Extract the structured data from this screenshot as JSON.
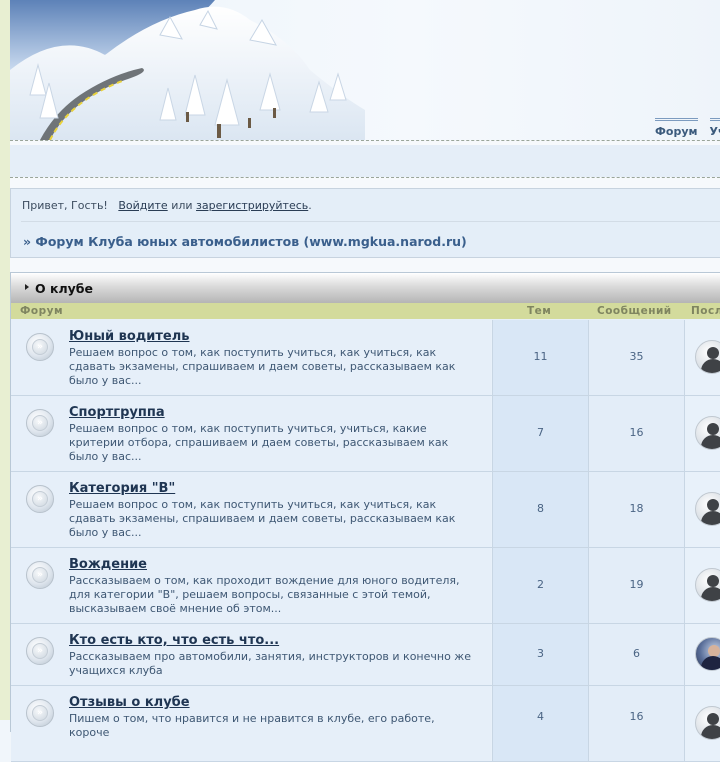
{
  "header": {
    "nav": [
      "Форум",
      "Уч"
    ]
  },
  "welcome": {
    "greeting": "Привет, Гость!",
    "login_link": "Войдите",
    "or_text": "или",
    "register_link": "зарегистрируйтесь",
    "breadcrumb": "» Форум Клуба юных автомобилистов (www.mgkua.narod.ru)"
  },
  "category": {
    "title": "О клубе",
    "columns": {
      "forum": "Форум",
      "topics": "Тем",
      "posts": "Сообщений",
      "last": "Посл"
    }
  },
  "forums": [
    {
      "title": "Юный водитель",
      "desc": "Решаем вопрос о том, как поступить учиться, как учиться, как сдавать экзамены, спрашиваем и даем советы, рассказываем как было у вас...",
      "topics": "11",
      "posts": "35",
      "avatar": "default"
    },
    {
      "title": "Спортгруппа",
      "desc": "Решаем вопрос о том, как поступить учиться, учиться, какие критерии отбора, спрашиваем и даем советы, рассказываем как было у вас...",
      "topics": "7",
      "posts": "16",
      "avatar": "default"
    },
    {
      "title": "Категория \"В\"",
      "desc": "Решаем вопрос о том, как поступить учиться, как учиться, как сдавать экзамены, спрашиваем и даем советы, рассказываем как было у вас...",
      "topics": "8",
      "posts": "18",
      "avatar": "default"
    },
    {
      "title": "Вождение",
      "desc": "Рассказываем о том, как проходит вождение для юного водителя, для категории \"В\", решаем вопросы, связанные с этой темой, высказываем своё мнение об этом...",
      "topics": "2",
      "posts": "19",
      "avatar": "default"
    },
    {
      "title": "Кто есть кто, что есть что...",
      "desc": "Рассказываем про автомобили, занятия, инструкторов и конечно же учащихся клуба",
      "topics": "3",
      "posts": "6",
      "avatar": "photo"
    },
    {
      "title": "Отзывы о клубе",
      "desc": "Пишем о том, что нравится и не нравится в клубе, его работе, короче",
      "topics": "4",
      "posts": "16",
      "avatar": "default"
    }
  ],
  "icons": {
    "forum": "forum-read-icon",
    "avatar": "user-avatar-icon"
  }
}
